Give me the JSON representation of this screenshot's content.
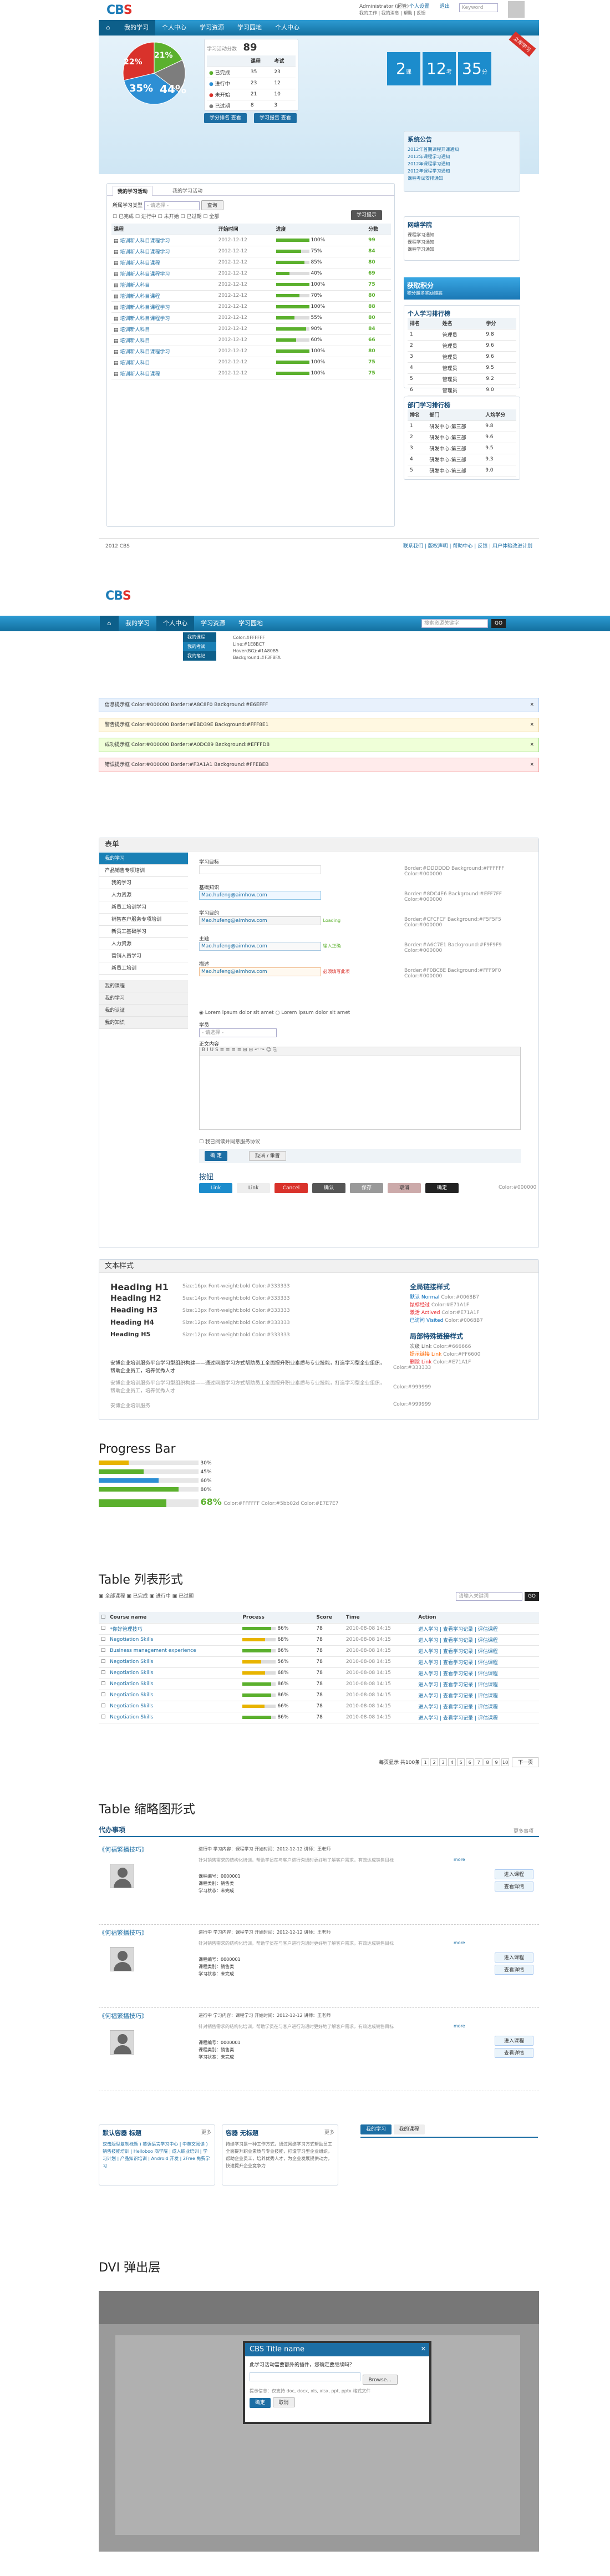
{
  "app": {
    "logo_main": "CB",
    "logo_accent": "S",
    "user": "Administrator (超管)",
    "menu_personal": "个人设置",
    "menu_logout": "退出",
    "links": [
      "我的工作",
      "我的消息",
      "帮助",
      "反馈"
    ],
    "search_placeholder": "Keyword",
    "go": "GO"
  },
  "nav": {
    "items": [
      "我的学习",
      "个人中心",
      "学习资源",
      "学习园地",
      "个人中心"
    ],
    "search_placeholder": "搜索资源关键字",
    "go": "GO"
  },
  "dashboard": {
    "pie": {
      "slices": [
        {
          "label": "22%",
          "value": 22,
          "color": "#5bb02d"
        },
        {
          "label": "21%",
          "value": 21,
          "color": "#7d7d7d"
        },
        {
          "label": "44%",
          "value": 44,
          "color": "#2d8fd4"
        },
        {
          "label": "35%",
          "value": 35,
          "color": "#d9322b"
        }
      ]
    },
    "stats": {
      "title": "学习活动分数",
      "score": "89",
      "col_a": "课程",
      "col_b": "考试",
      "rows": [
        {
          "label": "已完成",
          "a": "35",
          "b": "23",
          "color": "#5bb02d"
        },
        {
          "label": "进行中",
          "a": "23",
          "b": "12",
          "color": "#2d8fd4"
        },
        {
          "label": "未开始",
          "a": "21",
          "b": "10",
          "color": "#d9322b"
        },
        {
          "label": "已过期",
          "a": "8",
          "b": "3",
          "color": "#7d7d7d"
        }
      ],
      "btn_a": "学分排名 查看",
      "btn_b": "学习报告 查看"
    },
    "tiles": [
      {
        "num": "2",
        "unit": "课"
      },
      {
        "num": "12",
        "unit": "考"
      },
      {
        "num": "35",
        "unit": "分"
      }
    ],
    "ribbon": "立即学习"
  },
  "learn": {
    "tabs": [
      "我的学习活动",
      "我的学习活动"
    ],
    "filter_label": "所属学习类型",
    "filter_value": "- 请选择 -",
    "filter_btn": "查询",
    "checks": [
      "已完成",
      "进行中",
      "未开始",
      "已过期",
      "全部"
    ],
    "ribbon_btn": "学习提示",
    "headers": [
      "课程",
      "开始时间",
      "进度",
      "分数"
    ],
    "rows": [
      {
        "name": "培训新人科目课程学习",
        "date": "2012-12-12",
        "pct": "100%",
        "p": 100,
        "score": "99"
      },
      {
        "name": "培训新人科目课程学习",
        "date": "2012-12-12",
        "pct": "75%",
        "p": 75,
        "score": "84"
      },
      {
        "name": "培训新人科目课程",
        "date": "2012-12-12",
        "pct": "85%",
        "p": 85,
        "score": "80"
      },
      {
        "name": "培训新人科目课程学习",
        "date": "2012-12-12",
        "pct": "40%",
        "p": 40,
        "score": "69"
      },
      {
        "name": "培训新人科目",
        "date": "2012-12-12",
        "pct": "100%",
        "p": 100,
        "score": "75"
      },
      {
        "name": "培训新人科目课程",
        "date": "2012-12-12",
        "pct": "70%",
        "p": 70,
        "score": "80"
      },
      {
        "name": "培训新人科目课程学习",
        "date": "2012-12-12",
        "pct": "100%",
        "p": 100,
        "score": "88"
      },
      {
        "name": "培训新人科目课程学习",
        "date": "2012-12-12",
        "pct": "55%",
        "p": 55,
        "score": "80"
      },
      {
        "name": "培训新人科目",
        "date": "2012-12-12",
        "pct": "90%",
        "p": 90,
        "score": "84"
      },
      {
        "name": "培训新人科目",
        "date": "2012-12-12",
        "pct": "60%",
        "p": 60,
        "score": "66"
      },
      {
        "name": "培训新人科目课程学习",
        "date": "2012-12-12",
        "pct": "100%",
        "p": 100,
        "score": "80"
      },
      {
        "name": "培训新人科目",
        "date": "2012-12-12",
        "pct": "100%",
        "p": 100,
        "score": "75"
      },
      {
        "name": "培训新人科目课程",
        "date": "2012-12-12",
        "pct": "100%",
        "p": 100,
        "score": "75"
      }
    ]
  },
  "side": {
    "notice_title": "系统公告",
    "notices": [
      "2012年首期课程开课通知",
      "2012年课程学习通知",
      "2012年课程学习通知",
      "2012年课程学习通知",
      "课程考试安排通知"
    ],
    "news_title": "网络学院",
    "news": [
      "课程学习通知",
      "课程学习通知",
      "课程学习通知"
    ],
    "blue_btn": "获取积分",
    "blue_sub": "积分越多奖励越高",
    "rank_title": "个人学习排行榜",
    "rank_headers": [
      "排名",
      "姓名",
      "学分"
    ],
    "rank": [
      [
        "1",
        "管理员",
        "9.8"
      ],
      [
        "2",
        "管理员",
        "9.6"
      ],
      [
        "3",
        "管理员",
        "9.6"
      ],
      [
        "4",
        "管理员",
        "9.5"
      ],
      [
        "5",
        "管理员",
        "9.2"
      ],
      [
        "6",
        "管理员",
        "9.0"
      ]
    ],
    "dept_title": "部门学习排行榜",
    "dept_headers": [
      "排名",
      "部门",
      "人均学分"
    ],
    "dept": [
      [
        "1",
        "研发中心-第三部",
        "9.8"
      ],
      [
        "2",
        "研发中心-第三部",
        "9.6"
      ],
      [
        "3",
        "研发中心-第三部",
        "9.5"
      ],
      [
        "4",
        "研发中心-第三部",
        "9.3"
      ],
      [
        "5",
        "研发中心-第三部",
        "9.0"
      ]
    ]
  },
  "footer": {
    "left": "2012 CBS",
    "right": [
      "联系我们",
      "版权声明",
      "帮助中心",
      "反馈",
      "用户体验改进计划"
    ]
  },
  "header2": {
    "sub": [
      "我的课程",
      "我的考试",
      "我的笔记"
    ],
    "dropdown": [
      "Color:#FFFFFF",
      "Line:#1E8BC7",
      "Hover(BG):#1A80B5",
      "Background:#F3F8FA"
    ]
  },
  "alerts": [
    {
      "text": "信息提示框    Color:#000000   Border:#A8C8F0   Background:#E6EFFF",
      "bg": "#e8f1fc",
      "bd": "#a8c8f0"
    },
    {
      "text": "警告提示框    Color:#000000   Border:#EBD39E   Background:#FFF8E1",
      "bg": "#fff8e1",
      "bd": "#ebd39e"
    },
    {
      "text": "成功提示框    Color:#000000   Border:#A0DC89   Background:#EFFFD8",
      "bg": "#efffd8",
      "bd": "#a0dc89"
    },
    {
      "text": "错误提示框    Color:#000000   Border:#F3A1A1   Background:#FFEBEB",
      "bg": "#ffebeb",
      "bd": "#f3a1a1"
    }
  ],
  "forms": {
    "title": "表单",
    "menu_head": "我的学习",
    "menu": [
      "产品销售专项培训",
      "我的学习",
      "人力资源",
      "新员工培训学习",
      "销售客户服务专项培训",
      "新员工基础学习",
      "人力资源",
      "营销人员学习",
      "新员工培训"
    ],
    "menu_bottom": [
      "我的课程",
      "我的学习",
      "我的认证",
      "我的知识"
    ],
    "labels": [
      "学习目标",
      "基础知识",
      "学习目的",
      "主题",
      "描述"
    ],
    "values": [
      "",
      "Mao.hufeng@aimhow.com",
      "Mao.hufeng@aimhow.com",
      "Mao.hufeng@aimhow.com",
      "Mao.hufeng@aimhow.com"
    ],
    "specs": [
      "Border:#DDDDDD  Background:#FFFFFF  Color:#000000",
      "Border:#8DC4E6  Background:#EFF7FF  Color:#000000",
      "Border:#CFCFCF  Background:#F5F5F5  Color:#000000",
      "Border:#A6C7E1  Background:#F9F9F9  Color:#000000",
      "Border:#F0BC8E  Background:#FFF9F0  Color:#000000"
    ],
    "hints": [
      "",
      "",
      "Loading",
      "输入正确",
      "必须填写此项"
    ],
    "radio": [
      "Lorem ipsum dolor sit amet",
      "Lorem ipsum dolor sit amet"
    ],
    "select_label": "学员",
    "select_value": "- 请选择 -",
    "editor_label": "正文内容",
    "check": "我已阅读并同意服务协议",
    "btn_ok": "确 定",
    "btn_cancel": "取消 / 重置",
    "btn_title": "按钮",
    "btns": [
      "Link",
      "Link",
      "Cancel",
      "确认",
      "保存",
      "取消",
      "确定"
    ],
    "btn_spec": "Color:#000000"
  },
  "text": {
    "title": "文本样式",
    "headings": [
      {
        "h": "Heading H1",
        "spec": "Size:16px  Font-weight:bold  Color:#333333"
      },
      {
        "h": "Heading H2",
        "spec": "Size:14px  Font-weight:bold  Color:#333333"
      },
      {
        "h": "Heading H3",
        "spec": "Size:13px  Font-weight:bold  Color:#333333"
      },
      {
        "h": "Heading H4",
        "spec": "Size:12px  Font-weight:bold  Color:#333333"
      },
      {
        "h": "Heading H5",
        "spec": "Size:12px  Font-weight:bold  Color:#333333"
      }
    ],
    "link_title": "全局链接样式",
    "links": [
      [
        "默认 Normal",
        "Color:#0068B7"
      ],
      [
        "鼠标经过",
        "Color:#E71A1F"
      ],
      [
        "激活 Actived",
        "Color:#E71A1F"
      ],
      [
        "已访问 Visited",
        "Color:#0068B7"
      ]
    ],
    "special_title": "局部特殊链接样式",
    "special": [
      [
        "次级 Link",
        "Color:#666666"
      ],
      [
        "提示链接 Link",
        "Color:#FF6600"
      ],
      [
        "删除 Link",
        "Color:#E71A1F"
      ]
    ],
    "para1": "安博企业培训服务平台学习型组织构建——通过网络学习方式帮助员工全面提升职业素质与专业技能，打造学习型企业组织，帮助企业员工，培养优秀人才",
    "para1_spec": "Color:#333333",
    "para2": "安博企业培训服务平台学习型组织构建——通过网络学习方式帮助员工全面提升职业素质与专业技能，打造学习型企业组织，帮助企业员工，培养优秀人才",
    "para2_spec": "Color:#999999",
    "para3": "安博企业培训服务",
    "para3_spec": "Color:#999999"
  },
  "progress": {
    "title": "Progress Bar",
    "bars": [
      {
        "pct": "30%",
        "p": 30,
        "color": "#e8b400"
      },
      {
        "pct": "45%",
        "p": 45,
        "color": "#5bb02d"
      },
      {
        "pct": "60%",
        "p": 60,
        "color": "#2d8fd4"
      },
      {
        "pct": "80%",
        "p": 80,
        "color": "#5bb02d"
      }
    ],
    "big": "68%",
    "big_p": 68,
    "spec": "Color:#FFFFFF   Color:#5bb02d   Color:#E7E7E7"
  },
  "table1": {
    "title": "Table 列表形式",
    "tabs": [
      "全部课程",
      "已完成",
      "进行中",
      "已过期"
    ],
    "search_placeholder": "请输入关键词",
    "go": "GO",
    "headers": [
      "Course name",
      "Process",
      "Score",
      "Time",
      "Action"
    ],
    "rows": [
      {
        "name": "*你好管理技巧",
        "pct": "86%",
        "p": 86,
        "score": "78",
        "time": "2010-08-08 14:15",
        "act": "进入学习 | 查看学习记录 | 评估课程"
      },
      {
        "name": "Negotiation Skills",
        "pct": "68%",
        "p": 68,
        "score": "78",
        "time": "2010-08-08 14:15",
        "act": "进入学习 | 查看学习记录 | 评估课程"
      },
      {
        "name": "Business management experience",
        "pct": "86%",
        "p": 86,
        "score": "78",
        "time": "2010-08-08 14:15",
        "act": "进入学习 | 查看学习记录 | 评估课程"
      },
      {
        "name": "Negotiation Skills",
        "pct": "56%",
        "p": 56,
        "score": "78",
        "time": "2010-08-08 14:15",
        "act": "进入学习 | 查看学习记录 | 评估课程"
      },
      {
        "name": "Negotiation Skills",
        "pct": "68%",
        "p": 68,
        "score": "78",
        "time": "2010-08-08 14:15",
        "act": "进入学习 | 查看学习记录 | 评估课程"
      },
      {
        "name": "Negotiation Skills",
        "pct": "86%",
        "p": 86,
        "score": "78",
        "time": "2010-08-08 14:15",
        "act": "进入学习 | 查看学习记录 | 评估课程"
      },
      {
        "name": "Negotiation Skills",
        "pct": "86%",
        "p": 86,
        "score": "78",
        "time": "2010-08-08 14:15",
        "act": "进入学习 | 查看学习记录 | 评估课程"
      },
      {
        "name": "Negotiation Skills",
        "pct": "66%",
        "p": 66,
        "score": "78",
        "time": "2010-08-08 14:15",
        "act": "进入学习 | 查看学习记录 | 评估课程"
      },
      {
        "name": "Negotiation Skills",
        "pct": "86%",
        "p": 86,
        "score": "78",
        "time": "2010-08-08 14:15",
        "act": "进入学习 | 查看学习记录 | 评估课程"
      }
    ],
    "pager_label": "每页显示",
    "pager_total": "共100条",
    "pages": [
      "1",
      "2",
      "3",
      "4",
      "5",
      "6",
      "7",
      "8",
      "9",
      "10"
    ],
    "next": "下一页"
  },
  "table2": {
    "title": "Table 缩略图形式",
    "header": "代办事项",
    "more": "更多事项",
    "items": [
      {
        "title": "《何福繁播技巧》",
        "meta": "进行中   学习内容：课程学习   开始时间：2012-12-12   讲师：王老师",
        "desc": "针对销售需求的结构化培训，帮助学员在与客户进行沟通时更好地了解客户需求，有效达成销售目标",
        "info": [
          "课程编号：0000001",
          "课程类别：销售类",
          "学习状态：未完成"
        ],
        "more": "more",
        "b1": "进入课程",
        "b2": "查看详情"
      },
      {
        "title": "《何福繁播技巧》",
        "meta": "进行中   学习内容：课程学习   开始时间：2012-12-12   讲师：王老师",
        "desc": "针对销售需求的结构化培训，帮助学员在与客户进行沟通时更好地了解客户需求，有效达成销售目标",
        "info": [
          "课程编号：0000001",
          "课程类别：销售类",
          "学习状态：未完成"
        ],
        "more": "more",
        "b1": "进入课程",
        "b2": "查看详情"
      },
      {
        "title": "《何福繁播技巧》",
        "meta": "进行中   学习内容：课程学习   开始时间：2012-12-12   讲师：王老师",
        "desc": "针对销售需求的结构化培训，帮助学员在与客户进行沟通时更好地了解客户需求，有效达成销售目标",
        "info": [
          "课程编号：0000001",
          "课程类别：销售类",
          "学习状态：未完成"
        ],
        "more": "more",
        "b1": "进入课程",
        "b2": "查看详情"
      }
    ]
  },
  "boxes": {
    "b1_title": "默认容器 标题",
    "b1_more": "更多",
    "b1_text": "双击版型复制标题 ) 英语语言学习中心 | 中英文阅读 ) 销售技能培训 | Helloboo 商学院 | 成人职业培训 | 学习计划 | 产品知识培训 | Android 开发 | 2Free 免费学习",
    "b2_title": "容器 无标题",
    "b2_more": "更多",
    "b2_text": "持续学习是一种工作方式，通过网络学习方式帮助员工全面提升职业素质与专业技能，打造学习型企业组织，帮助企业员工，培养优秀人才，为企业发展提供动力，快速提升企业竞争力",
    "tab_a": "我的学习",
    "tab_b": "我的课程"
  },
  "popup": {
    "title": "DVI 弹出层",
    "dialog_title": "CBS Title name",
    "dialog_sub": "此学习活动需要额外的插件，您确定要继续吗？",
    "browse": "Browse...",
    "note": "提示信息：仅支持 doc, docx, xls, xlsx, ppt, pptx 格式文件",
    "ok": "确定",
    "cancel": "取消"
  }
}
